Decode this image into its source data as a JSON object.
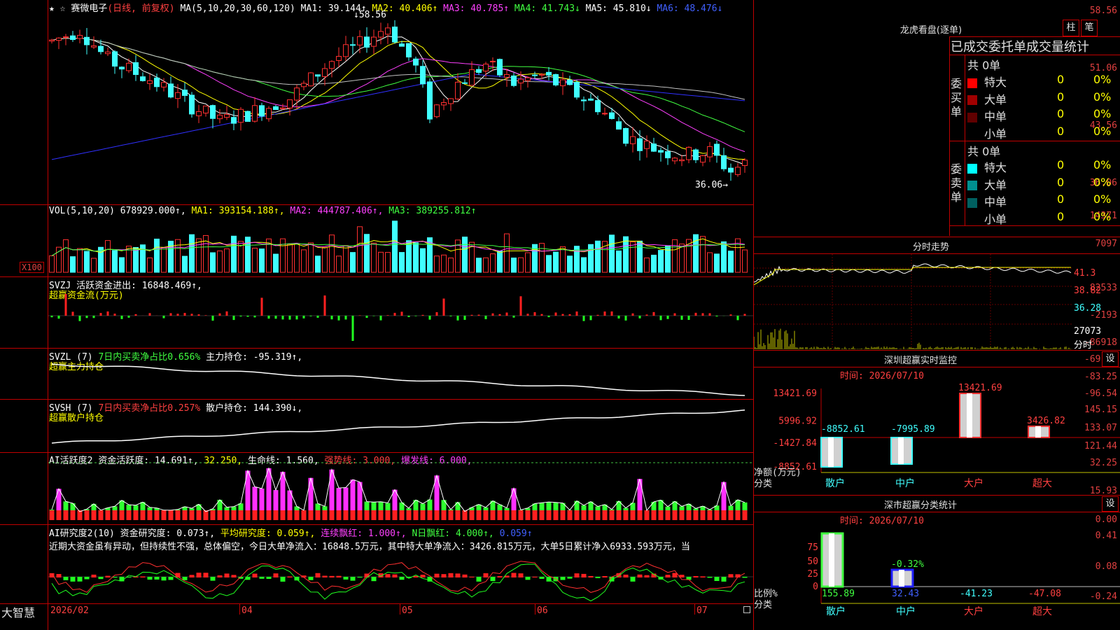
{
  "stock": {
    "star": "★",
    "star2": "☆",
    "name": "赛微电子",
    "mode": "(日线, 前复权)"
  },
  "ma_header": {
    "prefix": "MA(5,10,20,30,60,120)",
    "ma1": "MA1: 39.144↑",
    "ma2": "MA2: 40.406↑",
    "ma3": "MA3: 40.785↑",
    "ma4": "MA4: 41.743↓",
    "ma5": "MA5: 45.810↓",
    "ma6": "MA6: 48.476↓"
  },
  "price_axis": [
    "58.56",
    "51.06",
    "43.56",
    "36.06"
  ],
  "price_marks": {
    "high": "58.56",
    "low": "36.06→",
    "high_arrow": "↓"
  },
  "vol_header": {
    "prefix": "VOL(5,10,20)",
    "val": "678929.000↑,",
    "ma1": "MA1: 393154.188↑,",
    "ma2": "MA2: 444787.406↑,",
    "ma3": "MA3: 389255.812↑"
  },
  "vol_axis": [
    "14371",
    "7097",
    "X100"
  ],
  "svzj_header": {
    "name": "SVZJ",
    "val": "活跃资金进出: 16848.469↑,",
    "sub": "超赢资金流(万元)"
  },
  "svzj_axis": [
    "82533",
    "-2193",
    "-86918"
  ],
  "svzl_header": {
    "name": "SVZL (7)",
    "a": "7日内买卖净占比0.656%",
    "b": "主力持仓: -95.319↑,",
    "sub": "超赢主力持仓"
  },
  "svzl_axis": [
    "-69.97",
    "-83.25",
    "-96.54"
  ],
  "svsh_header": {
    "name": "SVSH (7)",
    "a": "7日内买卖净占比0.257%",
    "b": "散户持仓: 144.390↓,",
    "sub": "超赢散户持仓"
  },
  "svsh_axis": [
    "145.15",
    "133.07",
    "121.44"
  ],
  "ai_header": {
    "name": "AI活跃度2",
    "a": "资金活跃度: 14.691↑,",
    "b": "32.250,",
    "c": "生命线: 1.560,",
    "d": "强势线: 3.000,",
    "e": "爆发线: 6.000,"
  },
  "ai_axis": [
    "32.25",
    "15.93",
    "0.00"
  ],
  "ai2_header": {
    "name": "AI研究度2(10)",
    "a": "资金研究度: 0.073↑,",
    "b": "平均研究度: 0.059↑,",
    "c": "连续飘红: 1.000↑,",
    "d": "N日飘红: 4.000↑,",
    "e": "0.059↑"
  },
  "ai2_text": "近期大资金虽有异动，但持续性不强，总体偏空，今日大单净流入：16848.5万元，其中特大单净流入：3426.815万元，大单5日累计净入6933.593万元，当",
  "ai2_axis": [
    "0.41",
    "0.08",
    "-0.24"
  ],
  "date_axis": {
    "logo": "大智慧",
    "labels": [
      "2026/02",
      "04",
      "05",
      "06",
      "07"
    ]
  },
  "lhb": {
    "title": "龙虎看盘(逐单)",
    "btn1": "柱",
    "btn2": "笔",
    "sub": "已成交委托单成交量统计",
    "buy_label": "委买单",
    "sell_label": "委卖单",
    "buy_total": "共 0单",
    "sell_total": "共 0单",
    "buy_rows": [
      {
        "label": "特大",
        "color": "#ff0000",
        "n": "0",
        "p": "0%"
      },
      {
        "label": "大单",
        "color": "#a00000",
        "n": "0",
        "p": "0%"
      },
      {
        "label": "中单",
        "color": "#600000",
        "n": "0",
        "p": "0%"
      },
      {
        "label": "小单",
        "color": "#000000",
        "n": "0",
        "p": "0%"
      }
    ],
    "sell_rows": [
      {
        "label": "特大",
        "color": "#00ffff",
        "n": "0",
        "p": "0%"
      },
      {
        "label": "大单",
        "color": "#009090",
        "n": "0",
        "p": "0%"
      },
      {
        "label": "中单",
        "color": "#006060",
        "n": "0",
        "p": "0%"
      },
      {
        "label": "小单",
        "color": "#000000",
        "n": "0",
        "p": "0%"
      }
    ]
  },
  "fenshi": {
    "title": "分时走势",
    "axis": [
      "41.3",
      "38.82",
      "36.28",
      "27073",
      "分时"
    ]
  },
  "monitor": {
    "title": "深圳超赢实时监控",
    "btn": "设",
    "time": "时间: 2026/07/10",
    "axis": [
      "13421.69",
      "5996.92",
      "-1427.84",
      "-8852.61"
    ],
    "ylabel1": "净额(万元)",
    "ylabel2": "分类",
    "cats": [
      "散户",
      "中户",
      "大户",
      "超大"
    ],
    "values": [
      "-8852.61",
      "-7995.89",
      "13421.69",
      "3426.82"
    ]
  },
  "stats": {
    "title": "深市超赢分类统计",
    "btn": "设",
    "time": "时间: 2026/07/10",
    "axis": [
      "75",
      "50",
      "25",
      "0"
    ],
    "ylabel1": "比例%",
    "ylabel2": "分类",
    "cats": [
      "散户",
      "中户",
      "大户",
      "超大"
    ],
    "values": [
      "155.89",
      "32.43",
      "-41.23",
      "-47.08"
    ],
    "mid_label": "-0.32%"
  },
  "chart_data": {
    "type": "candlestick",
    "title": "赛微电子 (日线, 前复权)",
    "ylim": [
      36.06,
      58.56
    ],
    "x_range": [
      "2026/02",
      "2026/07"
    ],
    "ma_values": {
      "MA1": 39.144,
      "MA2": 40.406,
      "MA3": 40.785,
      "MA4": 41.743,
      "MA5": 45.81,
      "MA6": 48.476
    },
    "high": 58.56,
    "low": 36.06,
    "volume": {
      "current": 678929.0,
      "MA1": 393154.188,
      "MA2": 444787.406,
      "MA3": 389255.812
    },
    "colors": {
      "up": "#ff3030",
      "down": "#40ffff",
      "ma1": "#ffffff",
      "ma2": "#ffff00",
      "ma3": "#ff40ff",
      "ma4": "#40ff40",
      "ma5": "#c0c0c0",
      "ma6": "#4040ff"
    }
  }
}
